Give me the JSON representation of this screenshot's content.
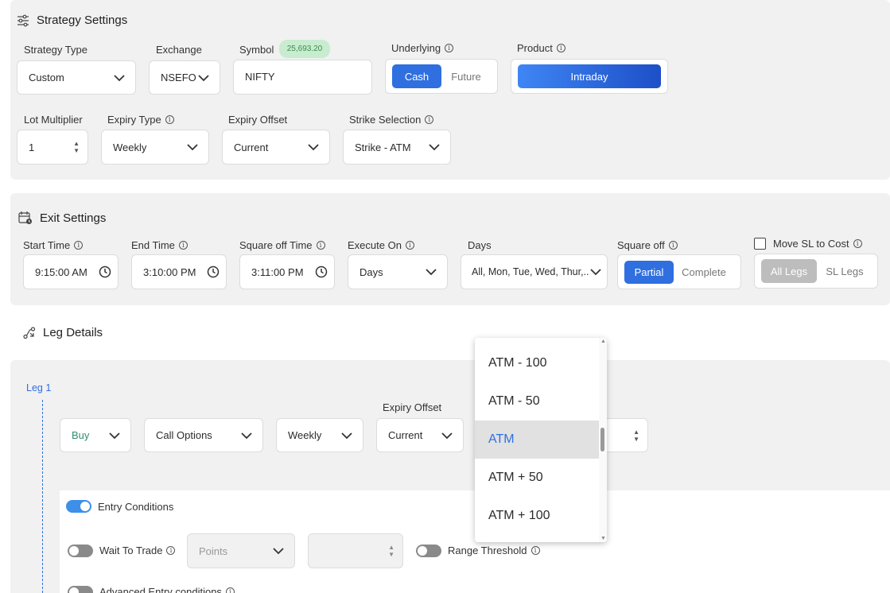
{
  "strategy": {
    "title": "Strategy Settings",
    "strategy_type": {
      "label": "Strategy Type",
      "value": "Custom"
    },
    "exchange": {
      "label": "Exchange",
      "value": "NSEFO"
    },
    "symbol": {
      "label": "Symbol",
      "badge": "25,693.20",
      "value": "NIFTY"
    },
    "underlying": {
      "label": "Underlying",
      "opt1": "Cash",
      "opt2": "Future"
    },
    "product": {
      "label": "Product",
      "value": "Intraday"
    },
    "lot_multiplier": {
      "label": "Lot Multiplier",
      "value": "1"
    },
    "expiry_type": {
      "label": "Expiry Type",
      "value": "Weekly"
    },
    "expiry_offset": {
      "label": "Expiry Offset",
      "value": "Current"
    },
    "strike_selection": {
      "label": "Strike Selection",
      "value": "Strike - ATM"
    }
  },
  "exit": {
    "title": "Exit Settings",
    "start_time": {
      "label": "Start Time",
      "value": "9:15:00 AM"
    },
    "end_time": {
      "label": "End Time",
      "value": "3:10:00 PM"
    },
    "square_off_time": {
      "label": "Square off Time",
      "value": "3:11:00 PM"
    },
    "execute_on": {
      "label": "Execute On",
      "value": "Days"
    },
    "days": {
      "label": "Days",
      "value": "All, Mon, Tue, Wed, Thur,..."
    },
    "square_off": {
      "label": "Square off",
      "opt1": "Partial",
      "opt2": "Complete"
    },
    "move_sl": {
      "label": "Move SL to Cost",
      "opt1": "All Legs",
      "opt2": "SL Legs"
    }
  },
  "legs": {
    "title": "Leg Details",
    "leg1_label": "Leg 1",
    "side": "Buy",
    "option_type": "Call Options",
    "expiry": "Weekly",
    "expiry_offset_label": "Expiry Offset",
    "expiry_offset": "Current",
    "entry_conditions": "Entry Conditions",
    "wait_to_trade": "Wait To Trade",
    "points_placeholder": "Points",
    "range_threshold": "Range Threshold",
    "advanced_entry": "Advanced Entry conditions"
  },
  "strike_dropdown": {
    "items": [
      "ATM - 100",
      "ATM - 50",
      "ATM",
      "ATM + 50",
      "ATM + 100"
    ],
    "selected": "ATM"
  },
  "colors": {
    "accent": "#2f6fe0",
    "panel": "#f1f1f1",
    "badge_bg": "#c8ecd0",
    "buy_text": "#2f8f6f"
  }
}
